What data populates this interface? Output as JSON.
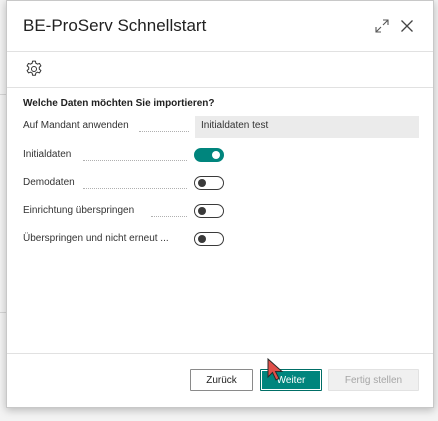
{
  "dialog": {
    "title": "BE-ProServ Schnellstart",
    "expand_icon": "expand-icon",
    "close_icon": "close-icon",
    "settings_icon": "gear-icon"
  },
  "form": {
    "section_title": "Welche Daten möchten Sie importieren?",
    "company_field": {
      "label": "Auf Mandant anwenden",
      "value": "Initialdaten test"
    },
    "toggles": [
      {
        "label": "Initialdaten",
        "on": true
      },
      {
        "label": "Demodaten",
        "on": false
      },
      {
        "label": "Einrichtung überspringen",
        "on": false
      },
      {
        "label": "Überspringen und nicht erneut ...",
        "on": false
      }
    ]
  },
  "footer": {
    "back_label": "Zurück",
    "next_label": "Weiter",
    "finish_label": "Fertig stellen",
    "finish_enabled": false
  },
  "colors": {
    "accent": "#00857d",
    "toggle_off_border": "#3a3a3a",
    "field_bg": "#ebebeb"
  }
}
